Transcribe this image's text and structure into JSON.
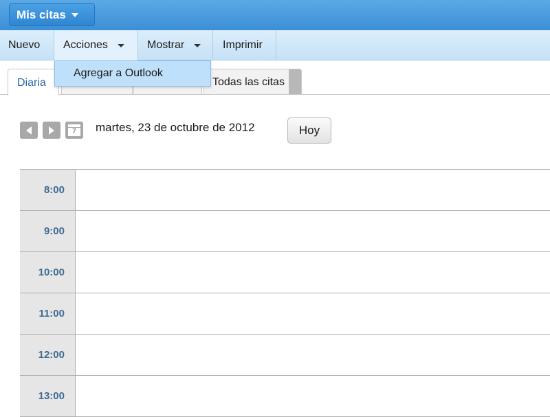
{
  "header": {
    "title": "Mis citas"
  },
  "menu": {
    "items": [
      {
        "label": "Nuevo"
      },
      {
        "label": "Acciones"
      },
      {
        "label": "Mostrar"
      },
      {
        "label": "Imprimir"
      }
    ],
    "dropdown_items": [
      {
        "label": "Agregar a Outlook"
      }
    ]
  },
  "tabs": [
    {
      "label": "Diaria"
    },
    {
      "label": ""
    },
    {
      "label": ""
    },
    {
      "label": "Todas las citas"
    }
  ],
  "date_nav": {
    "date": "martes, 23 de octubre de 2012",
    "today_label": "Hoy",
    "calendar_icon_day": "7"
  },
  "schedule": {
    "hours": [
      "8:00",
      "9:00",
      "10:00",
      "11:00",
      "12:00",
      "13:00"
    ]
  },
  "colors": {
    "header_blue": "#3d8fd6",
    "menubar_blue": "#c6e1f6",
    "time_text": "#3f6b93"
  }
}
